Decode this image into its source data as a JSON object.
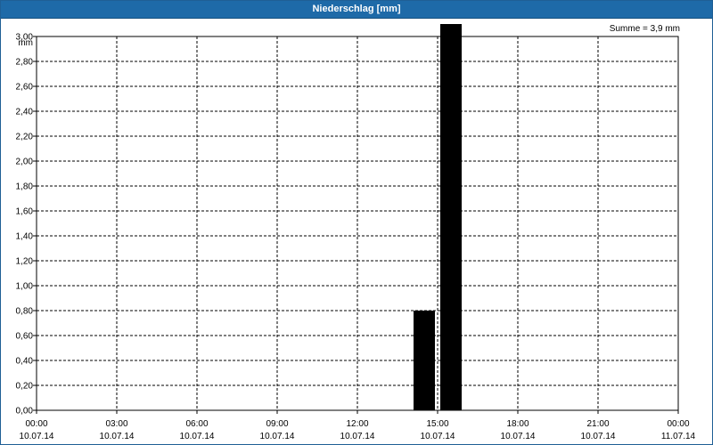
{
  "window": {
    "title": "Niederschlag [mm]"
  },
  "summary": {
    "text": "Summe = 3,9 mm"
  },
  "chart_data": {
    "type": "bar",
    "title": "Niederschlag [mm]",
    "ylabel": "mm",
    "ylim": [
      0,
      3.0
    ],
    "y_ticks": [
      "0,00",
      "0,20",
      "0,40",
      "0,60",
      "0,80",
      "1,00",
      "1,20",
      "1,40",
      "1,60",
      "1,80",
      "2,00",
      "2,20",
      "2,40",
      "2,60",
      "2,80",
      "3,00"
    ],
    "x_range_hours": [
      0,
      24
    ],
    "x_ticks": [
      {
        "time": "00:00",
        "date": "10.07.14"
      },
      {
        "time": "03:00",
        "date": "10.07.14"
      },
      {
        "time": "06:00",
        "date": "10.07.14"
      },
      {
        "time": "09:00",
        "date": "10.07.14"
      },
      {
        "time": "12:00",
        "date": "10.07.14"
      },
      {
        "time": "15:00",
        "date": "10.07.14"
      },
      {
        "time": "18:00",
        "date": "10.07.14"
      },
      {
        "time": "21:00",
        "date": "10.07.14"
      },
      {
        "time": "00:00",
        "date": "11.07.14"
      }
    ],
    "bars": [
      {
        "start_hour": 14.0,
        "end_hour": 15.0,
        "value": 0.8
      },
      {
        "start_hour": 15.0,
        "end_hour": 16.0,
        "value": 3.1
      }
    ],
    "grid": true,
    "bar_color": "#000000",
    "summary": "Summe = 3,9 mm"
  }
}
